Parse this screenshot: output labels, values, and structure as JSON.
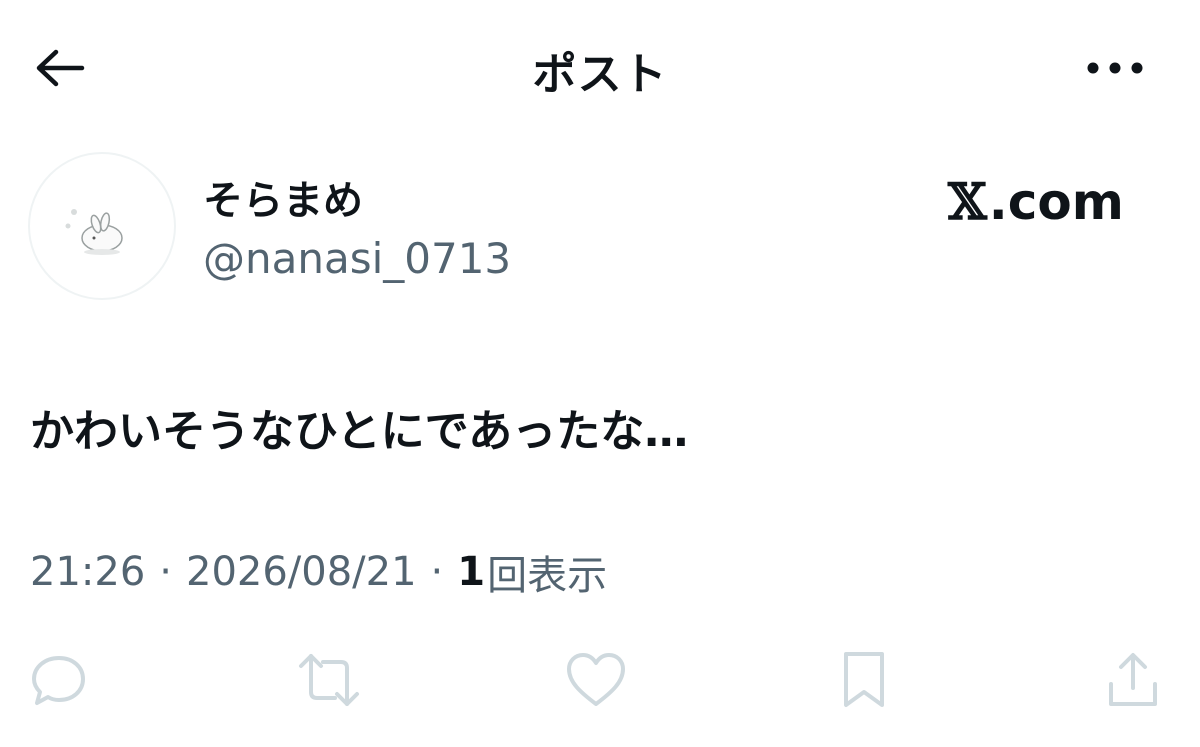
{
  "header": {
    "title": "ポスト",
    "back_icon": "arrow-left-icon",
    "more_icon": "more-dots-icon"
  },
  "author": {
    "display_name": "そらまめ",
    "handle": "@nanasi_0713",
    "avatar": "rabbit-avatar"
  },
  "watermark": {
    "x_logo": "𝕏",
    "domain": ".com"
  },
  "post": {
    "text": "かわいそうなひとにであったな…",
    "time": "21:26",
    "separator": "·",
    "date": "2026/08/21",
    "views_count": "1",
    "views_label": "回表示"
  },
  "actions": {
    "icons": [
      "reply-icon",
      "repost-icon",
      "like-icon",
      "bookmark-icon",
      "share-icon"
    ]
  },
  "colors": {
    "text": "#0f1419",
    "secondary": "#536471",
    "icon": "#cfd9de",
    "background": "#ffffff"
  }
}
